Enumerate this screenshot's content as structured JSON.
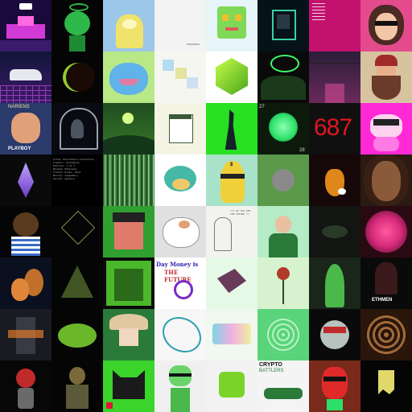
{
  "gallery": {
    "columns": 8,
    "rows": 8,
    "tiles": [
      {
        "name": "pink-castle-pixel-art",
        "colors": [
          "#1a0a3c",
          "#d23ad6"
        ]
      },
      {
        "name": "green-alien-halo-avatar",
        "colors": [
          "#050505",
          "#2fb84a"
        ]
      },
      {
        "name": "yellow-raincoat-creature",
        "colors": [
          "#9bc7e8",
          "#f0e36b"
        ]
      },
      {
        "name": "white-sketch-artwork",
        "colors": [
          "#f3f3f3",
          "#bbbbbb"
        ]
      },
      {
        "name": "green-robot-head",
        "colors": [
          "#e7f4fa",
          "#7ed957"
        ]
      },
      {
        "name": "neon-portrait-frame",
        "colors": [
          "#06121a",
          "#3cd0a0"
        ]
      },
      {
        "name": "magenta-text-card",
        "colors": [
          "#c2126e",
          "#ffffff"
        ]
      },
      {
        "name": "girl-with-sunglasses",
        "colors": [
          "#e44b8c",
          "#4a2a22"
        ]
      },
      {
        "name": "synthwave-car",
        "colors": [
          "#11163a",
          "#c84bd8"
        ]
      },
      {
        "name": "dark-planet-eclipse",
        "colors": [
          "#050505",
          "#b4ff3a"
        ]
      },
      {
        "name": "blue-frog-character",
        "colors": [
          "#b8e986",
          "#5fb3e8"
        ]
      },
      {
        "name": "pastel-geometric-blocks",
        "colors": [
          "#f6f6f0",
          "#b5dcef"
        ]
      },
      {
        "name": "green-hex-gem",
        "colors": [
          "#ffffff",
          "#7bd31b"
        ]
      },
      {
        "name": "green-silhouette-group",
        "colors": [
          "#0a0a0a",
          "#3cff6a"
        ]
      },
      {
        "name": "neon-city-street",
        "colors": [
          "#2b1d3a",
          "#d24a9a"
        ]
      },
      {
        "name": "bearded-man-beanie",
        "colors": [
          "#d8c3a0",
          "#6a3a2a"
        ]
      },
      {
        "name": "playboy-comic-portrait",
        "colors": [
          "#2a3a6a",
          "#e0a07a"
        ]
      },
      {
        "name": "dark-occult-frame",
        "colors": [
          "#0a0a12",
          "#9aa3ad"
        ]
      },
      {
        "name": "green-moon-landscape",
        "colors": [
          "#1f4d1f",
          "#d6ff8a"
        ]
      },
      {
        "name": "small-card-on-cream",
        "colors": [
          "#f3f4e4",
          "#3a5a3a"
        ]
      },
      {
        "name": "green-screen-horse",
        "colors": [
          "#28e022",
          "#15202a"
        ]
      },
      {
        "name": "green-x-orb",
        "colors": [
          "#0b1a0b",
          "#2de06a"
        ]
      },
      {
        "name": "red-687-digits",
        "colors": [
          "#101010",
          "#e0161f"
        ]
      },
      {
        "name": "pink-cat-corgi",
        "colors": [
          "#ff2ad5",
          "#ffd2f0"
        ]
      },
      {
        "name": "ethereum-diamond",
        "colors": [
          "#0a0a0a",
          "#8a5cf6"
        ]
      },
      {
        "name": "text-list-document",
        "colors": [
          "#000000",
          "#9a9a9a"
        ]
      },
      {
        "name": "glitch-stripes",
        "colors": [
          "#2a6a2a",
          "#a0d4a0"
        ]
      },
      {
        "name": "pufferfish-drawing",
        "colors": [
          "#ffffff",
          "#46b8a6"
        ]
      },
      {
        "name": "yellow-banana-ninja",
        "colors": [
          "#a8e2c8",
          "#f0d03a"
        ]
      },
      {
        "name": "grey-smiling-pebble",
        "colors": [
          "#5a9a4a",
          "#8a8a8a"
        ]
      },
      {
        "name": "orange-squash-cat",
        "colors": [
          "#160808",
          "#e0871a"
        ]
      },
      {
        "name": "3d-woman-portrait",
        "colors": [
          "#2a1a12",
          "#8a5a3a"
        ]
      },
      {
        "name": "cartoon-kid-striped",
        "colors": [
          "#050505",
          "#5a3a1e"
        ]
      },
      {
        "name": "constellation-lines",
        "colors": [
          "#050505",
          "#8a8a4a"
        ]
      },
      {
        "name": "pixel-punk-face",
        "colors": [
          "#30a030",
          "#e07a6a"
        ]
      },
      {
        "name": "white-cat-sticker",
        "colors": [
          "#e0e0e0",
          "#ffffff"
        ]
      },
      {
        "name": "pencil-sketch-future",
        "colors": [
          "#f2f2ee",
          "#7a7a7a"
        ]
      },
      {
        "name": "man-green-shirt-cartoon",
        "colors": [
          "#b5ebc6",
          "#2a7a3a"
        ]
      },
      {
        "name": "dark-hole-scene",
        "colors": [
          "#121512",
          "#2a3a2a"
        ]
      },
      {
        "name": "magenta-orb-mask",
        "colors": [
          "#2a0a12",
          "#d62a7a"
        ]
      },
      {
        "name": "orange-squirrel",
        "colors": [
          "#0a1020",
          "#e0863a"
        ]
      },
      {
        "name": "neon-triangle-web",
        "colors": [
          "#050505",
          "#6a8a3a"
        ]
      },
      {
        "name": "pixel-zombie-square",
        "colors": [
          "#0a0a0a",
          "#4ab82a"
        ]
      },
      {
        "name": "day-money-future-text",
        "colors": [
          "#ffffff",
          "#2a1fb0"
        ]
      },
      {
        "name": "origami-fox-shapes",
        "colors": [
          "#e6f8e6",
          "#6a3a5a"
        ]
      },
      {
        "name": "wilted-red-flower",
        "colors": [
          "#d7f2cf",
          "#b03a2a"
        ]
      },
      {
        "name": "green-hooded-figure",
        "colors": [
          "#1a261a",
          "#4ab84a"
        ]
      },
      {
        "name": "ethmen-dark-character",
        "colors": [
          "#0a0a0a",
          "#c02a3a"
        ]
      },
      {
        "name": "armored-warrior-fire",
        "colors": [
          "#1a1a22",
          "#e07a2a"
        ]
      },
      {
        "name": "mossy-planter-creature",
        "colors": [
          "#050505",
          "#6ab82a"
        ]
      },
      {
        "name": "mushroom-old-man",
        "colors": [
          "#2a7a3a",
          "#e0c8a0"
        ]
      },
      {
        "name": "colorful-line-drawing",
        "colors": [
          "#f7f7f7",
          "#2aa0b0"
        ]
      },
      {
        "name": "holographic-card",
        "colors": [
          "#f0f8ef",
          "#80d4e6"
        ]
      },
      {
        "name": "green-ripple-rings",
        "colors": [
          "#5ad47a",
          "#b8f2c4"
        ]
      },
      {
        "name": "robot-green-helmet",
        "colors": [
          "#0a0a0a",
          "#b8c2bf"
        ]
      },
      {
        "name": "brown-spiral-tunnel",
        "colors": [
          "#2a150a",
          "#a06a3a"
        ]
      },
      {
        "name": "red-hooded-figurine",
        "colors": [
          "#070707",
          "#c02a2a"
        ]
      },
      {
        "name": "sunglasses-cartoon-man",
        "colors": [
          "#050505",
          "#7a6a3a"
        ]
      },
      {
        "name": "pixel-black-cat",
        "colors": [
          "#3ad42a",
          "#1a1a1a"
        ]
      },
      {
        "name": "green-man-sunglasses",
        "colors": [
          "#f0f0f0",
          "#6ad46a"
        ]
      },
      {
        "name": "fuzzy-green-cube",
        "colors": [
          "#f2f2f2",
          "#7ad42a"
        ]
      },
      {
        "name": "crypto-tank-comic",
        "colors": [
          "#f4f4f4",
          "#2a7a3a"
        ]
      },
      {
        "name": "red-mascot-sunglasses",
        "colors": [
          "#7a2a1a",
          "#2ae06a"
        ]
      },
      {
        "name": "yellow-ghost-dark",
        "colors": [
          "#050505",
          "#e0d86a"
        ]
      }
    ],
    "texts": {
      "card_label_1": "FUTURE",
      "card_label_2": "PLAYBOY",
      "card_label_3": "NARIENS",
      "digits": "687",
      "badge_left": "27",
      "badge_right": "28",
      "sign": "$",
      "hand_line_1": "Day Money is",
      "hand_line_2": "THE FUTURE",
      "comic_title": "CRYPTO",
      "comic_sub": "BATTLERS",
      "ethmen": "ETHMEN",
      "sketch_words": "??? DO YOU SEE THE FUTURE ??",
      "doc_lines": "Title: Blockchain Collection\nCreator: Anonymous\nEdition: 1 of 1\nMinted: Ethereum\nTraits: Green, Dark\nRarity: Legendary\nSeries: Genesis"
    }
  }
}
